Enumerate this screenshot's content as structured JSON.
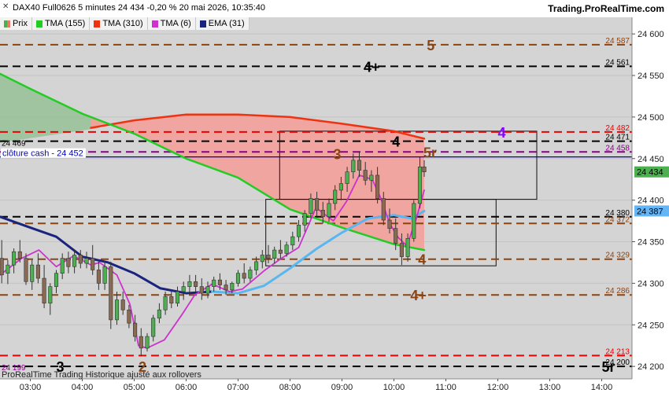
{
  "header": {
    "title": "DAX40 Full0626 5 minutes 24 434 -0,20 % 20 mai 2026, 10:35:40",
    "site": "Trading.ProRealTime.com",
    "footer": "ProRealTime Trading  Historique ajusté aux rollovers"
  },
  "legend": [
    {
      "label": "Prix",
      "color": "#e87a6a",
      "icon": "candle-icon"
    },
    {
      "label": "TMA (155)",
      "color": "#22cc22"
    },
    {
      "label": "TMA (310)",
      "color": "#ee3311"
    },
    {
      "label": "TMA (6)",
      "color": "#cc33cc"
    },
    {
      "label": "EMA (31)",
      "color": "#1a237e"
    }
  ],
  "chart_data": {
    "type": "candlestick",
    "ylim": [
      24185,
      24620
    ],
    "x_range": [
      "02:25",
      "14:35"
    ],
    "x_ticks": [
      "03:00",
      "04:00",
      "05:00",
      "06:00",
      "07:00",
      "08:00",
      "09:00",
      "10:00",
      "11:00",
      "12:00",
      "13:00",
      "14:00"
    ],
    "y_ticks": [
      "24 600",
      "24 550",
      "24 500",
      "24 450",
      "24 400",
      "24 350",
      "24 300",
      "24 250",
      "24 200"
    ],
    "levels": [
      {
        "value": 24587,
        "label": "24 587",
        "color": "#8b4513",
        "tag": "5",
        "tagColor": "#8b4513",
        "tagTime": "10:38"
      },
      {
        "value": 24561,
        "label": "24 561",
        "color": "#000000",
        "tag": "4+",
        "tagColor": "#000000",
        "tagTime": "09:25"
      },
      {
        "value": 24482,
        "label": "24 482",
        "color": "#ee0000",
        "tag": "4",
        "tagColor": "#8b00ff",
        "tagTime": "12:00"
      },
      {
        "value": 24471,
        "label": "24 471",
        "color": "#000000",
        "tag": "4",
        "tagColor": "#000000",
        "tagTime": "09:58"
      },
      {
        "value": 24458,
        "label": "24 458",
        "color": "#8b008b",
        "tag": "5r",
        "tagColor": "#8b4513",
        "tagTime": "10:34"
      },
      {
        "value": 24380,
        "label": "24 380",
        "color": "#000000",
        "tag": "",
        "tagColor": "",
        "tagTime": ""
      },
      {
        "value": 24372,
        "label": "24 372",
        "color": "#8b4513",
        "tag": "",
        "tagColor": "",
        "tagTime": ""
      },
      {
        "value": 24329,
        "label": "24 329",
        "color": "#8b4513",
        "tag": "4",
        "tagColor": "#8b4513",
        "tagTime": "10:28"
      },
      {
        "value": 24286,
        "label": "24 286",
        "color": "#8b4513",
        "tag": "4+",
        "tagColor": "#8b4513",
        "tagTime": "10:19"
      },
      {
        "value": 24213,
        "label": "24 213",
        "color": "#ee0000",
        "tag": "",
        "tagColor": "",
        "tagTime": ""
      },
      {
        "value": 24200,
        "label": "24 200",
        "color": "#000000",
        "tag": "5r",
        "tagColor": "#000000",
        "tagTime": "14:00"
      }
    ],
    "cash_close": {
      "value": 24452,
      "label": "clôture cash -  24 452",
      "color": "#0000cc"
    },
    "price_labels": [
      {
        "value": 24434,
        "label": "24 434",
        "bg": "#4caf50"
      },
      {
        "value": 24387,
        "label": "24 387",
        "bg": "#64b5f6"
      }
    ],
    "left_labels": [
      {
        "value": 24469,
        "label": "24 469",
        "color": "#000000"
      },
      {
        "value": 24199,
        "label": "24 199",
        "color": "#8b008b"
      }
    ],
    "annotations": [
      {
        "text": "3",
        "time": "03:30",
        "value": 24200,
        "color": "#000000"
      },
      {
        "text": "2",
        "time": "05:05",
        "value": 24200,
        "color": "#8b4513"
      },
      {
        "text": "3",
        "time": "08:50",
        "value": 24456,
        "color": "#8b4513"
      }
    ],
    "boxes": [
      {
        "t0": "07:48",
        "t1": "12:45",
        "v0": 24401,
        "v1": 24483
      },
      {
        "t0": "07:32",
        "t1": "11:58",
        "v0": 24321,
        "v1": 24401
      }
    ],
    "tma155": [
      [
        "02:25",
        24552
      ],
      [
        "03:00",
        24534
      ],
      [
        "04:00",
        24504
      ],
      [
        "05:00",
        24480
      ],
      [
        "06:00",
        24450
      ],
      [
        "07:00",
        24427
      ],
      [
        "08:00",
        24389
      ],
      [
        "09:00",
        24367
      ],
      [
        "10:00",
        24347
      ],
      [
        "10:35",
        24340
      ]
    ],
    "tma310": [
      [
        "04:10",
        24487
      ],
      [
        "05:00",
        24496
      ],
      [
        "06:00",
        24503
      ],
      [
        "07:00",
        24503
      ],
      [
        "08:00",
        24500
      ],
      [
        "09:00",
        24492
      ],
      [
        "10:00",
        24483
      ],
      [
        "10:35",
        24474
      ]
    ],
    "ema31": [
      [
        "02:25",
        24380
      ],
      [
        "03:00",
        24367
      ],
      [
        "03:30",
        24356
      ],
      [
        "04:00",
        24332
      ],
      [
        "04:30",
        24325
      ],
      [
        "05:00",
        24312
      ],
      [
        "05:30",
        24294
      ],
      [
        "06:00",
        24288
      ],
      [
        "06:30",
        24290
      ],
      [
        "07:00",
        24288
      ],
      [
        "07:30",
        24297
      ],
      [
        "08:00",
        24318
      ],
      [
        "08:30",
        24341
      ],
      [
        "09:00",
        24361
      ],
      [
        "09:30",
        24378
      ],
      [
        "10:00",
        24382
      ],
      [
        "10:20",
        24378
      ],
      [
        "10:35",
        24387
      ]
    ],
    "tma6": [
      [
        "02:25",
        24310
      ],
      [
        "02:50",
        24330
      ],
      [
        "03:10",
        24340
      ],
      [
        "03:30",
        24320
      ],
      [
        "03:50",
        24333
      ],
      [
        "04:10",
        24322
      ],
      [
        "04:20",
        24325
      ],
      [
        "04:40",
        24310
      ],
      [
        "04:55",
        24275
      ],
      [
        "05:05",
        24225
      ],
      [
        "05:15",
        24222
      ],
      [
        "05:35",
        24232
      ],
      [
        "05:55",
        24262
      ],
      [
        "06:10",
        24286
      ],
      [
        "06:30",
        24299
      ],
      [
        "06:50",
        24290
      ],
      [
        "07:05",
        24293
      ],
      [
        "07:30",
        24315
      ],
      [
        "07:50",
        24330
      ],
      [
        "08:10",
        24343
      ],
      [
        "08:30",
        24391
      ],
      [
        "08:50",
        24375
      ],
      [
        "09:05",
        24398
      ],
      [
        "09:20",
        24430
      ],
      [
        "09:35",
        24425
      ],
      [
        "09:45",
        24402
      ],
      [
        "09:55",
        24372
      ],
      [
        "10:05",
        24355
      ],
      [
        "10:15",
        24345
      ],
      [
        "10:25",
        24375
      ],
      [
        "10:35",
        24412
      ]
    ],
    "candles": [
      [
        "02:27",
        24330,
        24352,
        24300,
        24310
      ],
      [
        "02:34",
        24312,
        24328,
        24299,
        24322
      ],
      [
        "02:41",
        24322,
        24342,
        24312,
        24338
      ],
      [
        "02:48",
        24338,
        24352,
        24325,
        24330
      ],
      [
        "02:55",
        24330,
        24336,
        24298,
        24302
      ],
      [
        "03:02",
        24302,
        24328,
        24292,
        24322
      ],
      [
        "03:09",
        24322,
        24336,
        24300,
        24306
      ],
      [
        "03:16",
        24306,
        24322,
        24270,
        24276
      ],
      [
        "03:23",
        24276,
        24300,
        24262,
        24296
      ],
      [
        "03:30",
        24296,
        24316,
        24288,
        24312
      ],
      [
        "03:37",
        24312,
        24336,
        24305,
        24330
      ],
      [
        "03:44",
        24330,
        24338,
        24312,
        24320
      ],
      [
        "03:51",
        24320,
        24340,
        24312,
        24334
      ],
      [
        "03:58",
        24334,
        24340,
        24318,
        24324
      ],
      [
        "04:05",
        24324,
        24338,
        24318,
        24330
      ],
      [
        "04:12",
        24330,
        24346,
        24310,
        24316
      ],
      [
        "04:19",
        24316,
        24326,
        24292,
        24300
      ],
      [
        "04:26",
        24300,
        24326,
        24292,
        24320
      ],
      [
        "04:33",
        24320,
        24326,
        24245,
        24256
      ],
      [
        "04:40",
        24256,
        24290,
        24250,
        24280
      ],
      [
        "04:47",
        24280,
        24290,
        24262,
        24268
      ],
      [
        "04:54",
        24268,
        24274,
        24246,
        24252
      ],
      [
        "05:01",
        24252,
        24262,
        24230,
        24236
      ],
      [
        "05:08",
        24236,
        24246,
        24212,
        24222
      ],
      [
        "05:15",
        24222,
        24240,
        24218,
        24236
      ],
      [
        "05:22",
        24236,
        24262,
        24230,
        24258
      ],
      [
        "05:29",
        24258,
        24276,
        24252,
        24268
      ],
      [
        "05:36",
        24268,
        24290,
        24262,
        24284
      ],
      [
        "05:43",
        24284,
        24292,
        24270,
        24276
      ],
      [
        "05:50",
        24276,
        24296,
        24272,
        24290
      ],
      [
        "05:57",
        24290,
        24302,
        24280,
        24296
      ],
      [
        "06:04",
        24296,
        24310,
        24288,
        24302
      ],
      [
        "06:11",
        24302,
        24310,
        24290,
        24296
      ],
      [
        "06:18",
        24296,
        24306,
        24280,
        24288
      ],
      [
        "06:25",
        24288,
        24302,
        24282,
        24296
      ],
      [
        "06:32",
        24296,
        24308,
        24290,
        24304
      ],
      [
        "06:39",
        24304,
        24312,
        24292,
        24298
      ],
      [
        "06:46",
        24298,
        24304,
        24286,
        24292
      ],
      [
        "06:53",
        24292,
        24302,
        24288,
        24300
      ],
      [
        "07:00",
        24300,
        24316,
        24296,
        24312
      ],
      [
        "07:07",
        24312,
        24324,
        24300,
        24306
      ],
      [
        "07:14",
        24306,
        24320,
        24302,
        24316
      ],
      [
        "07:21",
        24316,
        24332,
        24310,
        24326
      ],
      [
        "07:28",
        24326,
        24340,
        24318,
        24334
      ],
      [
        "07:35",
        24334,
        24346,
        24324,
        24330
      ],
      [
        "07:42",
        24330,
        24344,
        24324,
        24340
      ],
      [
        "07:49",
        24340,
        24352,
        24330,
        24336
      ],
      [
        "07:56",
        24336,
        24350,
        24332,
        24346
      ],
      [
        "08:03",
        24346,
        24362,
        24340,
        24356
      ],
      [
        "08:10",
        24356,
        24376,
        24350,
        24370
      ],
      [
        "08:17",
        24370,
        24388,
        24362,
        24384
      ],
      [
        "08:24",
        24384,
        24408,
        24378,
        24402
      ],
      [
        "08:31",
        24402,
        24410,
        24380,
        24388
      ],
      [
        "08:38",
        24388,
        24398,
        24372,
        24380
      ],
      [
        "08:45",
        24380,
        24402,
        24374,
        24396
      ],
      [
        "08:52",
        24396,
        24418,
        24388,
        24412
      ],
      [
        "08:59",
        24412,
        24428,
        24400,
        24420
      ],
      [
        "09:06",
        24420,
        24440,
        24410,
        24434
      ],
      [
        "09:13",
        24434,
        24456,
        24426,
        24448
      ],
      [
        "09:20",
        24448,
        24458,
        24428,
        24436
      ],
      [
        "09:27",
        24436,
        24446,
        24418,
        24424
      ],
      [
        "09:34",
        24424,
        24436,
        24410,
        24430
      ],
      [
        "09:41",
        24430,
        24440,
        24396,
        24402
      ],
      [
        "09:48",
        24402,
        24410,
        24370,
        24376
      ],
      [
        "09:55",
        24376,
        24390,
        24360,
        24366
      ],
      [
        "10:02",
        24366,
        24378,
        24340,
        24348
      ],
      [
        "10:09",
        24348,
        24360,
        24322,
        24332
      ],
      [
        "10:16",
        24332,
        24360,
        24326,
        24354
      ],
      [
        "10:23",
        24354,
        24400,
        24350,
        24396
      ],
      [
        "10:30",
        24396,
        24452,
        24390,
        24440
      ],
      [
        "10:35",
        24440,
        24448,
        24428,
        24434
      ]
    ]
  }
}
